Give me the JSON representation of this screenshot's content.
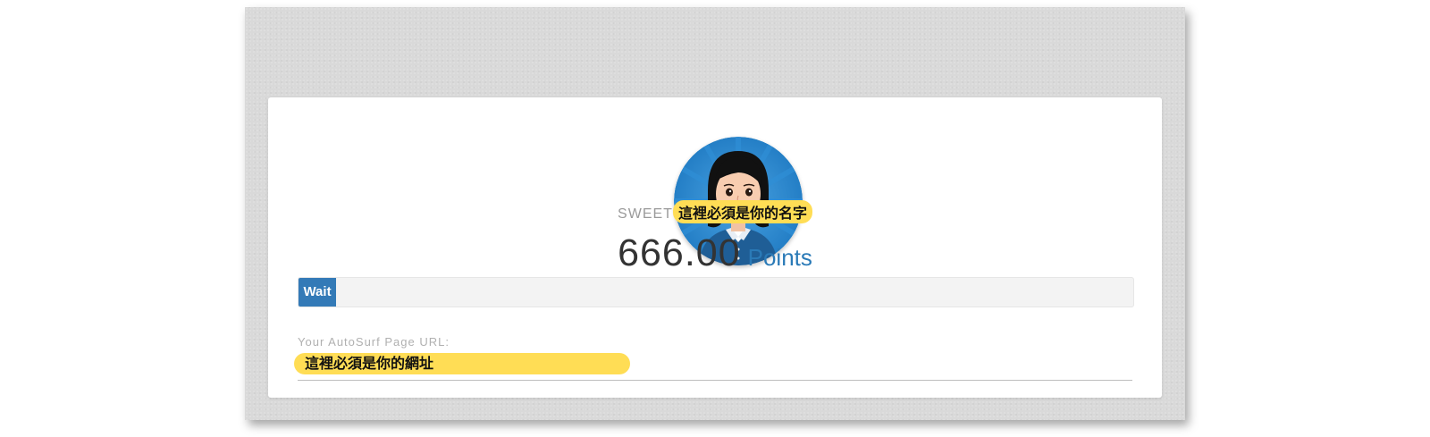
{
  "profile": {
    "name_prefix": "SWEET",
    "name_highlight": "這裡必須是你的名字",
    "avatar_icon": "woman-avatar-icon"
  },
  "points": {
    "value": "666.00",
    "unit": "Points"
  },
  "progress": {
    "label": "Wait",
    "fraction": 0.045,
    "color": "#337ab7"
  },
  "url": {
    "label": "Your AutoSurf Page URL:",
    "value": "這裡必須是你的網址"
  },
  "colors": {
    "accent": "#2a7ab7",
    "highlight": "#ffdd55"
  }
}
